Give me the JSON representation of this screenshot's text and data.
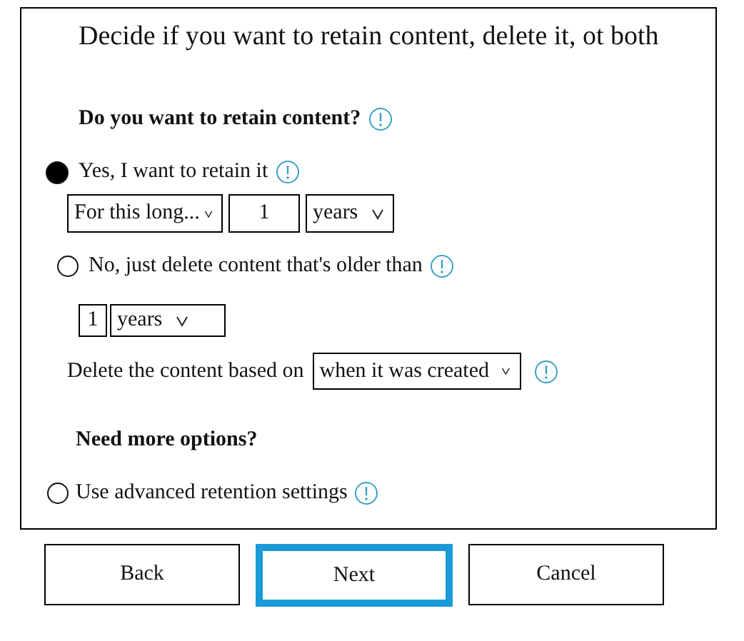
{
  "title": "Decide if you want to retain content, delete it, ot both",
  "retain_question": "Do you want to retain content?",
  "retain_option": {
    "label": "Yes, I want to retain it",
    "selected": true,
    "duration": "For this long...",
    "amount": "1",
    "unit": "years"
  },
  "delete_option": {
    "label": "No, just delete content that's older than",
    "selected": false,
    "amount": "1",
    "unit": "years"
  },
  "delete_basis": {
    "label": "Delete the content based on",
    "value": "when it was created"
  },
  "more_options": {
    "heading": "Need more options?",
    "advanced_option": {
      "label": "Use advanced retention settings",
      "selected": false
    }
  },
  "buttons": [
    {
      "label": "Back",
      "focused": false
    },
    {
      "label": "Next",
      "focused": true
    },
    {
      "label": "Cancel",
      "focused": false
    }
  ]
}
